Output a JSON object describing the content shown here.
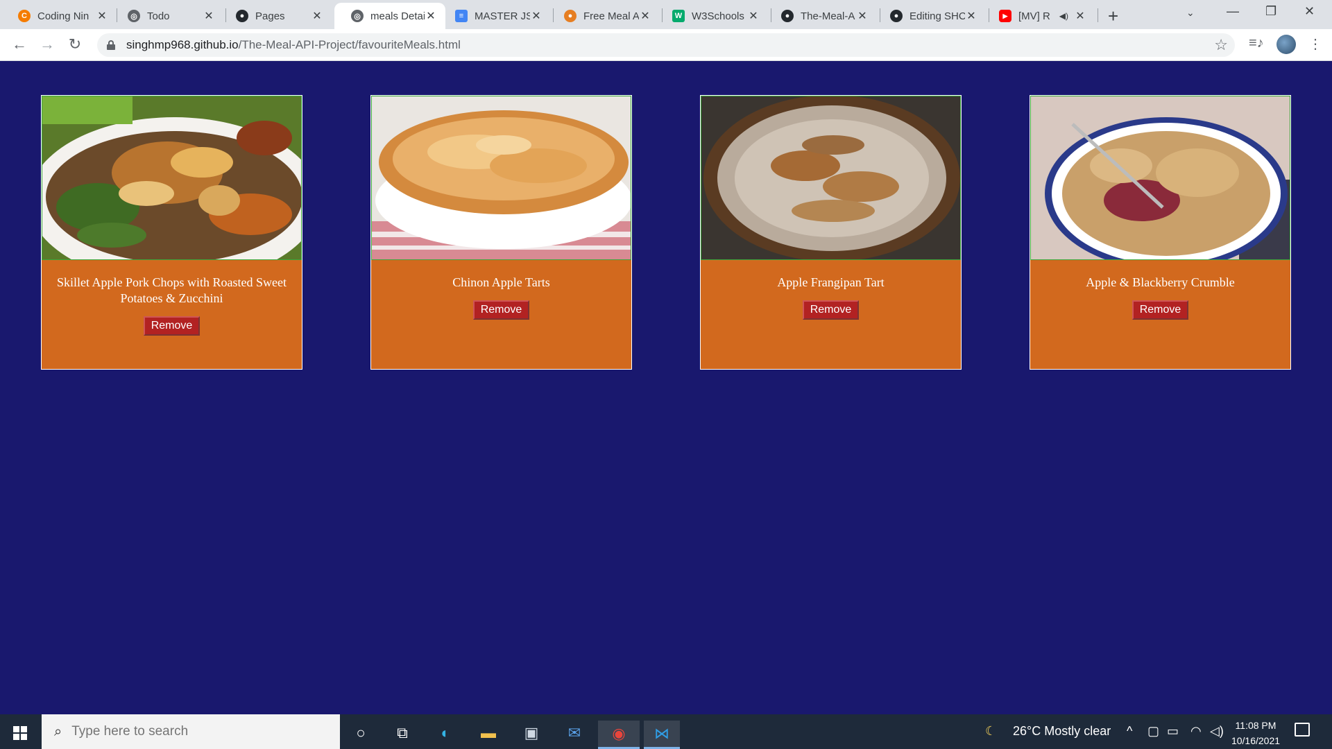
{
  "browser": {
    "tabs": [
      {
        "title": "Coding Nin",
        "favicon_color": "#f57c00",
        "favicon_glyph": "C"
      },
      {
        "title": "Todo",
        "favicon_color": "#5f6368",
        "favicon_glyph": "◎"
      },
      {
        "title": "Pages",
        "favicon_color": "#24292e",
        "favicon_glyph": "●"
      },
      {
        "title": "meals Detai",
        "favicon_color": "#5f6368",
        "favicon_glyph": "◎",
        "active": true
      },
      {
        "title": "MASTER JS",
        "favicon_color": "#4285f4",
        "favicon_glyph": "≡"
      },
      {
        "title": "Free Meal A",
        "favicon_color": "#e67e22",
        "favicon_glyph": "●"
      },
      {
        "title": "W3Schools",
        "favicon_color": "#04aa6d",
        "favicon_glyph": "W"
      },
      {
        "title": "The-Meal-A",
        "favicon_color": "#24292e",
        "favicon_glyph": "●"
      },
      {
        "title": "Editing SHC",
        "favicon_color": "#24292e",
        "favicon_glyph": "●"
      },
      {
        "title": "[MV] R",
        "favicon_color": "#ff0000",
        "favicon_glyph": "▶",
        "audio": true
      }
    ],
    "url_host": "singhmp968.github.io",
    "url_path": "/The-Meal-API-Project/favouriteMeals.html"
  },
  "meals": [
    {
      "title": "Skillet Apple Pork Chops with Roasted Sweet Potatoes & Zucchini",
      "button": "Remove"
    },
    {
      "title": "Chinon Apple Tarts",
      "button": "Remove"
    },
    {
      "title": "Apple Frangipan Tart",
      "button": "Remove"
    },
    {
      "title": "Apple & Blackberry Crumble",
      "button": "Remove"
    }
  ],
  "taskbar": {
    "search_placeholder": "Type here to search",
    "weather": "26°C  Mostly clear",
    "time": "11:08 PM",
    "date": "10/16/2021"
  },
  "colors": {
    "page_bg": "#19186e",
    "card_bg": "#d2691e",
    "button_bg": "#b22222"
  }
}
